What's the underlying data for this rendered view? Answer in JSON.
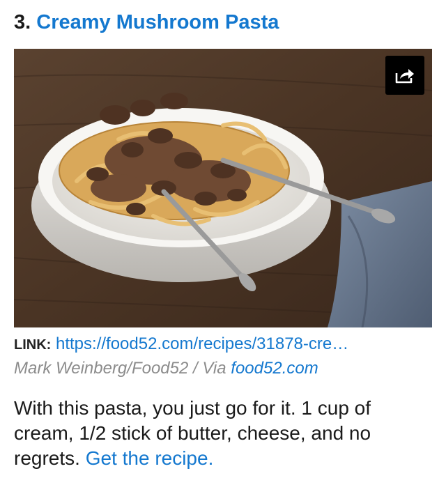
{
  "heading": {
    "number": "3.",
    "title": "Creamy Mushroom Pasta"
  },
  "photo": {
    "alt": "Creamy Mushroom Pasta",
    "share_icon": "share-arrow-icon"
  },
  "link": {
    "label": "LINK:",
    "url": "https://food52.com/recipes/31878-cre…"
  },
  "credit": {
    "text": "Mark Weinberg/Food52 / Via ",
    "source": "food52.com"
  },
  "body": {
    "text": "With this pasta, you just go for it. 1 cup of cream, 1/2 stick of butter, cheese, and no regrets. ",
    "link_text": "Get the recipe."
  },
  "colors": {
    "link": "#1478cf",
    "credit": "#8c8c8c",
    "text": "#1a1a1a"
  }
}
